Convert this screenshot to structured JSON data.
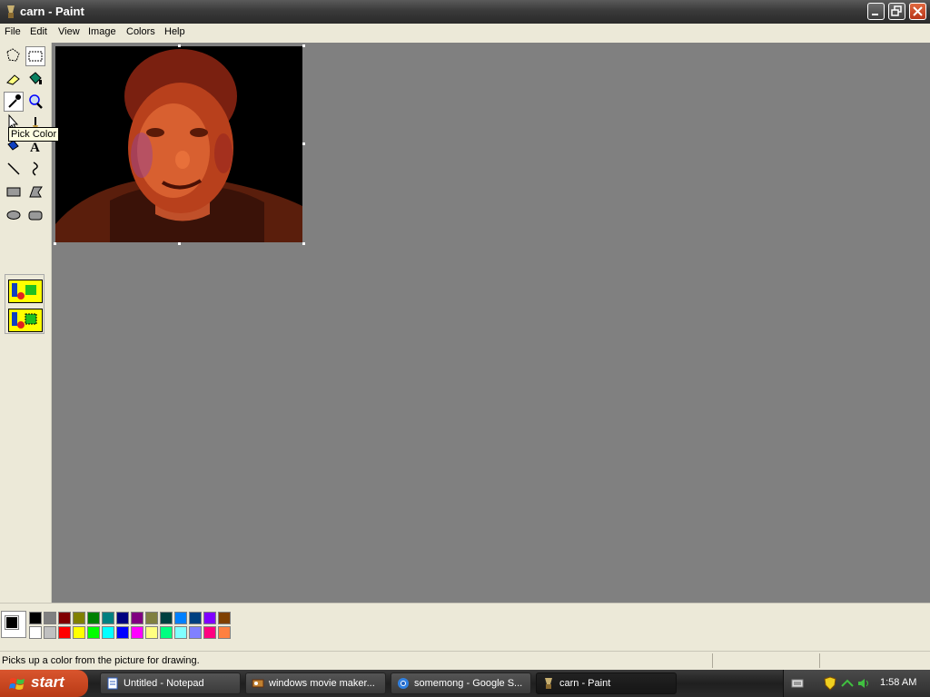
{
  "window": {
    "title": "carn - Paint"
  },
  "menu": [
    "File",
    "Edit",
    "View",
    "Image",
    "Colors",
    "Help"
  ],
  "tooltip": "Pick Color",
  "status": {
    "text": "Picks up a color from the picture for drawing."
  },
  "palette": {
    "top": [
      "#000000",
      "#808080",
      "#800000",
      "#808000",
      "#008000",
      "#008080",
      "#000080",
      "#800080",
      "#808040",
      "#004040",
      "#0080ff",
      "#004080",
      "#8000ff",
      "#804000"
    ],
    "bottom": [
      "#ffffff",
      "#c0c0c0",
      "#ff0000",
      "#ffff00",
      "#00ff00",
      "#00ffff",
      "#0000ff",
      "#ff00ff",
      "#ffff80",
      "#00ff80",
      "#80ffff",
      "#8080ff",
      "#ff0080",
      "#ff8040"
    ]
  },
  "taskbar": {
    "start_label": "start",
    "tasks": [
      {
        "label": "Untitled - Notepad"
      },
      {
        "label": "windows movie maker..."
      },
      {
        "label": "somemong - Google S..."
      },
      {
        "label": "carn - Paint"
      }
    ],
    "clock": "1:58 AM"
  }
}
